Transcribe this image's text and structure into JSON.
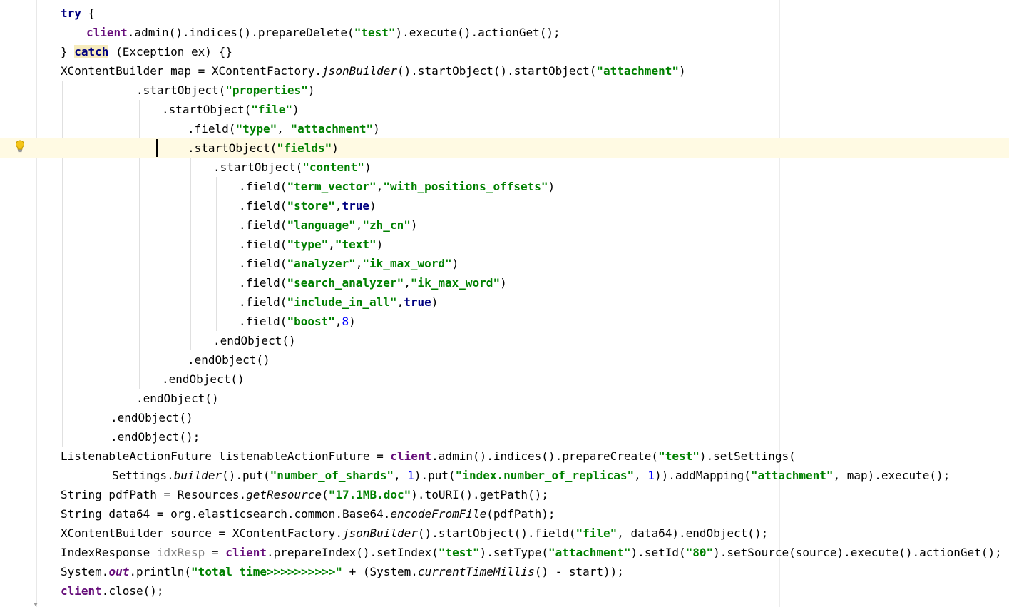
{
  "editor": {
    "lines": [
      {
        "segments": [
          {
            "t": "try",
            "c": "kw"
          },
          {
            "t": " {"
          }
        ]
      },
      {
        "segments": [
          {
            "t": "client",
            "c": "fld"
          },
          {
            "t": ".admin().indices().prepareDelete("
          },
          {
            "t": "\"test\"",
            "c": "str"
          },
          {
            "t": ").execute().actionGet();"
          }
        ]
      },
      {
        "segments": [
          {
            "t": "} "
          },
          {
            "t": "catch",
            "c": "kw hl"
          },
          {
            "t": " (Exception ex) {}"
          }
        ]
      },
      {
        "segments": [
          {
            "t": "XContentBuilder map = XContentFactory."
          },
          {
            "t": "jsonBuilder",
            "c": "it"
          },
          {
            "t": "().startObject().startObject("
          },
          {
            "t": "\"attachment\"",
            "c": "str"
          },
          {
            "t": ")"
          }
        ]
      },
      {
        "segments": [
          {
            "t": ".startObject("
          },
          {
            "t": "\"properties\"",
            "c": "str"
          },
          {
            "t": ")"
          }
        ]
      },
      {
        "segments": [
          {
            "t": ".startObject("
          },
          {
            "t": "\"file\"",
            "c": "str"
          },
          {
            "t": ")"
          }
        ]
      },
      {
        "segments": [
          {
            "t": ".field("
          },
          {
            "t": "\"type\"",
            "c": "str"
          },
          {
            "t": ", "
          },
          {
            "t": "\"attachment\"",
            "c": "str"
          },
          {
            "t": ")"
          }
        ]
      },
      {
        "segments": [
          {
            "t": ".startObject("
          },
          {
            "t": "\"fields\"",
            "c": "str"
          },
          {
            "t": ")"
          }
        ]
      },
      {
        "segments": [
          {
            "t": ".startObject("
          },
          {
            "t": "\"content\"",
            "c": "str"
          },
          {
            "t": ")"
          }
        ]
      },
      {
        "segments": [
          {
            "t": ".field("
          },
          {
            "t": "\"term_vector\"",
            "c": "str"
          },
          {
            "t": ","
          },
          {
            "t": "\"with_positions_offsets\"",
            "c": "str"
          },
          {
            "t": ")"
          }
        ]
      },
      {
        "segments": [
          {
            "t": ".field("
          },
          {
            "t": "\"store\"",
            "c": "str"
          },
          {
            "t": ","
          },
          {
            "t": "true",
            "c": "kw"
          },
          {
            "t": ")"
          }
        ]
      },
      {
        "segments": [
          {
            "t": ".field("
          },
          {
            "t": "\"language\"",
            "c": "str"
          },
          {
            "t": ","
          },
          {
            "t": "\"zh_cn\"",
            "c": "str"
          },
          {
            "t": ")"
          }
        ]
      },
      {
        "segments": [
          {
            "t": ".field("
          },
          {
            "t": "\"type\"",
            "c": "str"
          },
          {
            "t": ","
          },
          {
            "t": "\"text\"",
            "c": "str"
          },
          {
            "t": ")"
          }
        ]
      },
      {
        "segments": [
          {
            "t": ".field("
          },
          {
            "t": "\"analyzer\"",
            "c": "str"
          },
          {
            "t": ","
          },
          {
            "t": "\"ik_max_word\"",
            "c": "str"
          },
          {
            "t": ")"
          }
        ]
      },
      {
        "segments": [
          {
            "t": ".field("
          },
          {
            "t": "\"search_analyzer\"",
            "c": "str"
          },
          {
            "t": ","
          },
          {
            "t": "\"ik_max_word\"",
            "c": "str"
          },
          {
            "t": ")"
          }
        ]
      },
      {
        "segments": [
          {
            "t": ".field("
          },
          {
            "t": "\"include_in_all\"",
            "c": "str"
          },
          {
            "t": ","
          },
          {
            "t": "true",
            "c": "kw"
          },
          {
            "t": ")"
          }
        ]
      },
      {
        "segments": [
          {
            "t": ".field("
          },
          {
            "t": "\"boost\"",
            "c": "str"
          },
          {
            "t": ","
          },
          {
            "t": "8",
            "c": "num"
          },
          {
            "t": ")"
          }
        ]
      },
      {
        "segments": [
          {
            "t": ".endObject()"
          }
        ]
      },
      {
        "segments": [
          {
            "t": ".endObject()"
          }
        ]
      },
      {
        "segments": [
          {
            "t": ".endObject()"
          }
        ]
      },
      {
        "segments": [
          {
            "t": ".endObject()"
          }
        ]
      },
      {
        "segments": [
          {
            "t": ".endObject()"
          }
        ]
      },
      {
        "segments": [
          {
            "t": ".endObject();"
          }
        ]
      },
      {
        "segments": [
          {
            "t": "ListenableActionFuture listenableActionFuture = "
          },
          {
            "t": "client",
            "c": "fld"
          },
          {
            "t": ".admin().indices().prepareCreate("
          },
          {
            "t": "\"test\"",
            "c": "str"
          },
          {
            "t": ").setSettings("
          }
        ]
      },
      {
        "segments": [
          {
            "t": "Settings."
          },
          {
            "t": "builder",
            "c": "it"
          },
          {
            "t": "().put("
          },
          {
            "t": "\"number_of_shards\"",
            "c": "str"
          },
          {
            "t": ", "
          },
          {
            "t": "1",
            "c": "num"
          },
          {
            "t": ").put("
          },
          {
            "t": "\"index.number_of_replicas\"",
            "c": "str"
          },
          {
            "t": ", "
          },
          {
            "t": "1",
            "c": "num"
          },
          {
            "t": ")).addMapping("
          },
          {
            "t": "\"attachment\"",
            "c": "str"
          },
          {
            "t": ", map).execute();"
          }
        ]
      },
      {
        "segments": [
          {
            "t": "String pdfPath = Resources."
          },
          {
            "t": "getResource",
            "c": "it"
          },
          {
            "t": "("
          },
          {
            "t": "\"17.1MB.doc\"",
            "c": "str"
          },
          {
            "t": ").toURI().getPath();"
          }
        ]
      },
      {
        "segments": [
          {
            "t": "String data64 = org.elasticsearch.common.Base64."
          },
          {
            "t": "encodeFromFile",
            "c": "it"
          },
          {
            "t": "(pdfPath);"
          }
        ]
      },
      {
        "segments": [
          {
            "t": "XContentBuilder source = XContentFactory."
          },
          {
            "t": "jsonBuilder",
            "c": "it"
          },
          {
            "t": "().startObject().field("
          },
          {
            "t": "\"file\"",
            "c": "str"
          },
          {
            "t": ", data64).endObject();"
          }
        ]
      },
      {
        "segments": [
          {
            "t": "IndexResponse "
          },
          {
            "t": "idxResp",
            "c": "unused"
          },
          {
            "t": " = "
          },
          {
            "t": "client",
            "c": "fld"
          },
          {
            "t": ".prepareIndex().setIndex("
          },
          {
            "t": "\"test\"",
            "c": "str"
          },
          {
            "t": ").setType("
          },
          {
            "t": "\"attachment\"",
            "c": "str"
          },
          {
            "t": ").setId("
          },
          {
            "t": "\"80\"",
            "c": "str"
          },
          {
            "t": ").setSource(source).execute().actionGet();"
          }
        ]
      },
      {
        "segments": [
          {
            "t": "System."
          },
          {
            "t": "out",
            "c": "fldit"
          },
          {
            "t": ".println("
          },
          {
            "t": "\"total time>>>>>>>>>>\"",
            "c": "str"
          },
          {
            "t": " + (System."
          },
          {
            "t": "currentTimeMillis",
            "c": "it"
          },
          {
            "t": "() - start));"
          }
        ]
      },
      {
        "segments": [
          {
            "t": "client",
            "c": "fld"
          },
          {
            "t": ".close();"
          }
        ]
      }
    ],
    "current_line": 8,
    "icons": {
      "gutter": "lightbulb-icon"
    }
  }
}
